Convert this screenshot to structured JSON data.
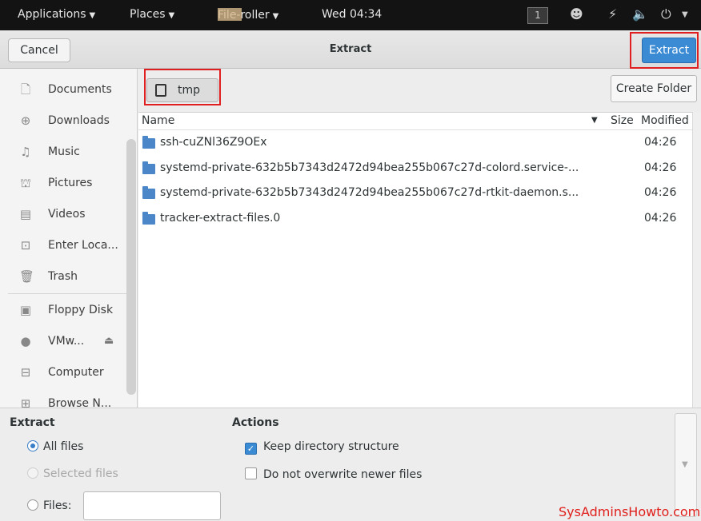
{
  "topbar": {
    "applications": "Applications",
    "places": "Places",
    "app_name": "File-roller",
    "clock": "Wed 04:34",
    "workspace": "1"
  },
  "dialog": {
    "title": "Extract",
    "cancel_label": "Cancel",
    "extract_label": "Extract"
  },
  "sidebar": {
    "items": [
      {
        "label": "Documents",
        "icon": "document-icon"
      },
      {
        "label": "Downloads",
        "icon": "download-icon"
      },
      {
        "label": "Music",
        "icon": "music-icon"
      },
      {
        "label": "Pictures",
        "icon": "pictures-icon"
      },
      {
        "label": "Videos",
        "icon": "videos-icon"
      },
      {
        "label": "Enter Loca...",
        "icon": "location-icon"
      },
      {
        "label": "Trash",
        "icon": "trash-icon"
      },
      {
        "label": "Floppy Disk",
        "icon": "floppy-icon"
      },
      {
        "label": "VMw...",
        "icon": "disc-icon"
      },
      {
        "label": "Computer",
        "icon": "computer-icon"
      },
      {
        "label": "Browse N...",
        "icon": "network-icon"
      }
    ]
  },
  "pathbar": {
    "current": "tmp",
    "create_folder": "Create Folder"
  },
  "filelist": {
    "columns": {
      "name": "Name",
      "size": "Size",
      "modified": "Modified"
    },
    "rows": [
      {
        "name": "ssh-cuZNl36Z9OEx",
        "modified": "04:26"
      },
      {
        "name": "systemd-private-632b5b7343d2472d94bea255b067c27d-colord.service-...",
        "modified": "04:26"
      },
      {
        "name": "systemd-private-632b5b7343d2472d94bea255b067c27d-rtkit-daemon.s...",
        "modified": "04:26"
      },
      {
        "name": "tracker-extract-files.0",
        "modified": "04:26"
      }
    ]
  },
  "options": {
    "extract_title": "Extract",
    "all_files": "All files",
    "selected_files": "Selected files",
    "files": "Files:",
    "files_value": "",
    "actions_title": "Actions",
    "keep_structure": "Keep directory structure",
    "no_overwrite": "Do not overwrite newer files"
  },
  "watermark": "SysAdminsHowto.com",
  "colors": {
    "accent": "#3a8ad4",
    "highlight": "#e02020",
    "folder": "#4a86c8"
  }
}
